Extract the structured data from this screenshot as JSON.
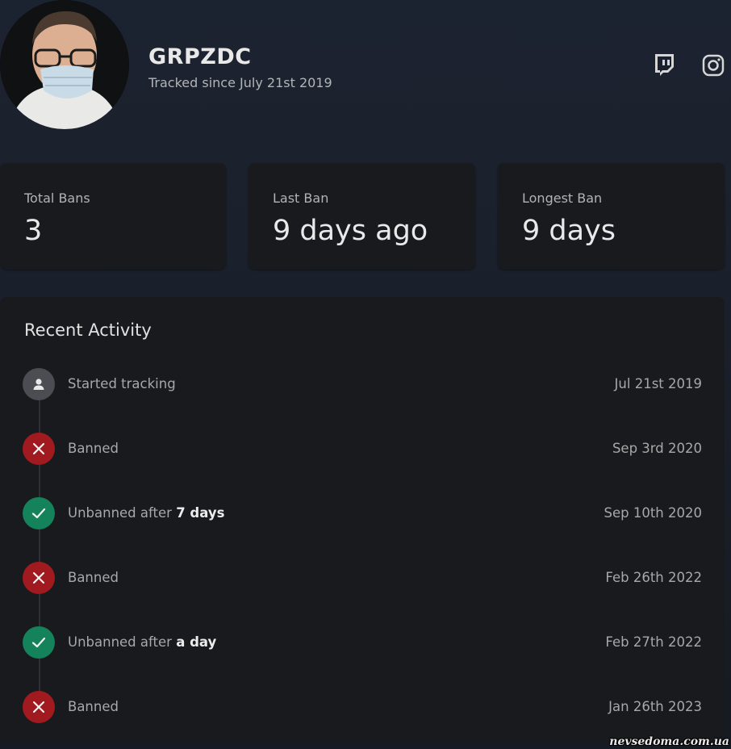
{
  "profile": {
    "name": "GRPZDC",
    "tracked_since": "Tracked since July 21st 2019",
    "avatar_icon": "user-avatar-photo"
  },
  "social": [
    {
      "name": "twitch",
      "icon": "twitch-icon"
    },
    {
      "name": "instagram",
      "icon": "instagram-icon"
    }
  ],
  "stats": [
    {
      "label": "Total Bans",
      "value": "3"
    },
    {
      "label": "Last Ban",
      "value": "9 days ago"
    },
    {
      "label": "Longest Ban",
      "value": "9 days"
    }
  ],
  "activity": {
    "title": "Recent Activity",
    "items": [
      {
        "type": "neutral",
        "icon": "person-icon",
        "text": "Started tracking",
        "bold": "",
        "date": "Jul 21st 2019"
      },
      {
        "type": "ban",
        "icon": "x-icon",
        "text": "Banned",
        "bold": "",
        "date": "Sep 3rd 2020"
      },
      {
        "type": "unban",
        "icon": "check-icon",
        "text": "Unbanned after ",
        "bold": "7 days",
        "date": "Sep 10th 2020"
      },
      {
        "type": "ban",
        "icon": "x-icon",
        "text": "Banned",
        "bold": "",
        "date": "Feb 26th 2022"
      },
      {
        "type": "unban",
        "icon": "check-icon",
        "text": "Unbanned after ",
        "bold": "a day",
        "date": "Feb 27th 2022"
      },
      {
        "type": "ban",
        "icon": "x-icon",
        "text": "Banned",
        "bold": "",
        "date": "Jan 26th 2023"
      }
    ]
  },
  "watermark": "nevsedoma.com.ua",
  "colors": {
    "ban": "#a01a1f",
    "unban": "#14825a",
    "neutral": "#4b4d52",
    "card": "#191a1d"
  }
}
